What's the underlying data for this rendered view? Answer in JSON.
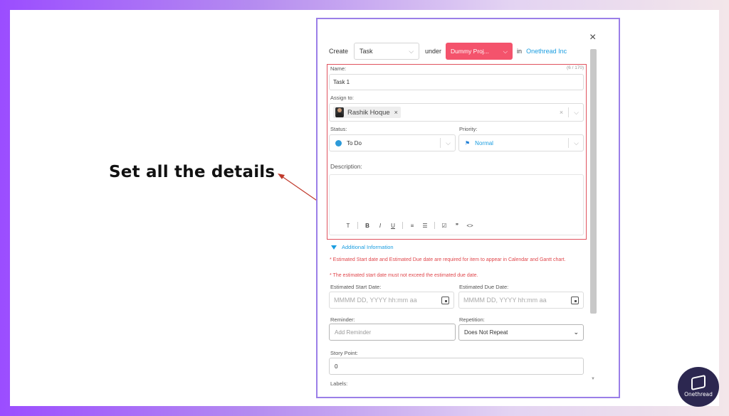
{
  "callout": {
    "text": "Set all the details"
  },
  "modal": {
    "close_icon": "×",
    "create_label": "Create",
    "type_value": "Task",
    "under_label": "under",
    "project_value": "Dummy Proj...",
    "in_label": "in",
    "org_link": "Onethread Inc",
    "name": {
      "label": "Name:",
      "counter": "(6 / 170)",
      "value": "Task 1"
    },
    "assign": {
      "label": "Assign to:",
      "chip": "Rashik Hoque",
      "chip_remove": "×",
      "clear": "×"
    },
    "status": {
      "label": "Status:",
      "value": "To Do",
      "color": "#2d9ad9"
    },
    "priority": {
      "label": "Priority:",
      "value": "Normal",
      "color": "#1a9de0"
    },
    "description": {
      "label": "Description:"
    },
    "toolbar": [
      "T",
      "B",
      "I",
      "U",
      "≡",
      "☰",
      "☑",
      "❞",
      "<>"
    ],
    "additional_info": "Additional Information",
    "warnings": [
      "* Estimated Start date and Estimated Due date are required for item to appear in Calendar and Gantt chart.",
      "* The estimated start date must not exceed the estimated due date."
    ],
    "start_date": {
      "label": "Estimated Start Date:",
      "placeholder": "MMMM DD, YYYY hh:mm aa"
    },
    "due_date": {
      "label": "Estimated Due Date:",
      "placeholder": "MMMM DD, YYYY hh:mm aa"
    },
    "reminder": {
      "label": "Reminder:",
      "placeholder": "Add Reminder"
    },
    "repetition": {
      "label": "Repetition:",
      "value": "Does Not Repeat"
    },
    "story_point": {
      "label": "Story Point:",
      "value": "0"
    },
    "labels": {
      "label": "Labels:"
    }
  },
  "brand": {
    "name": "Onethread",
    "accent": "#f4536c",
    "link_color": "#1a9de0"
  }
}
